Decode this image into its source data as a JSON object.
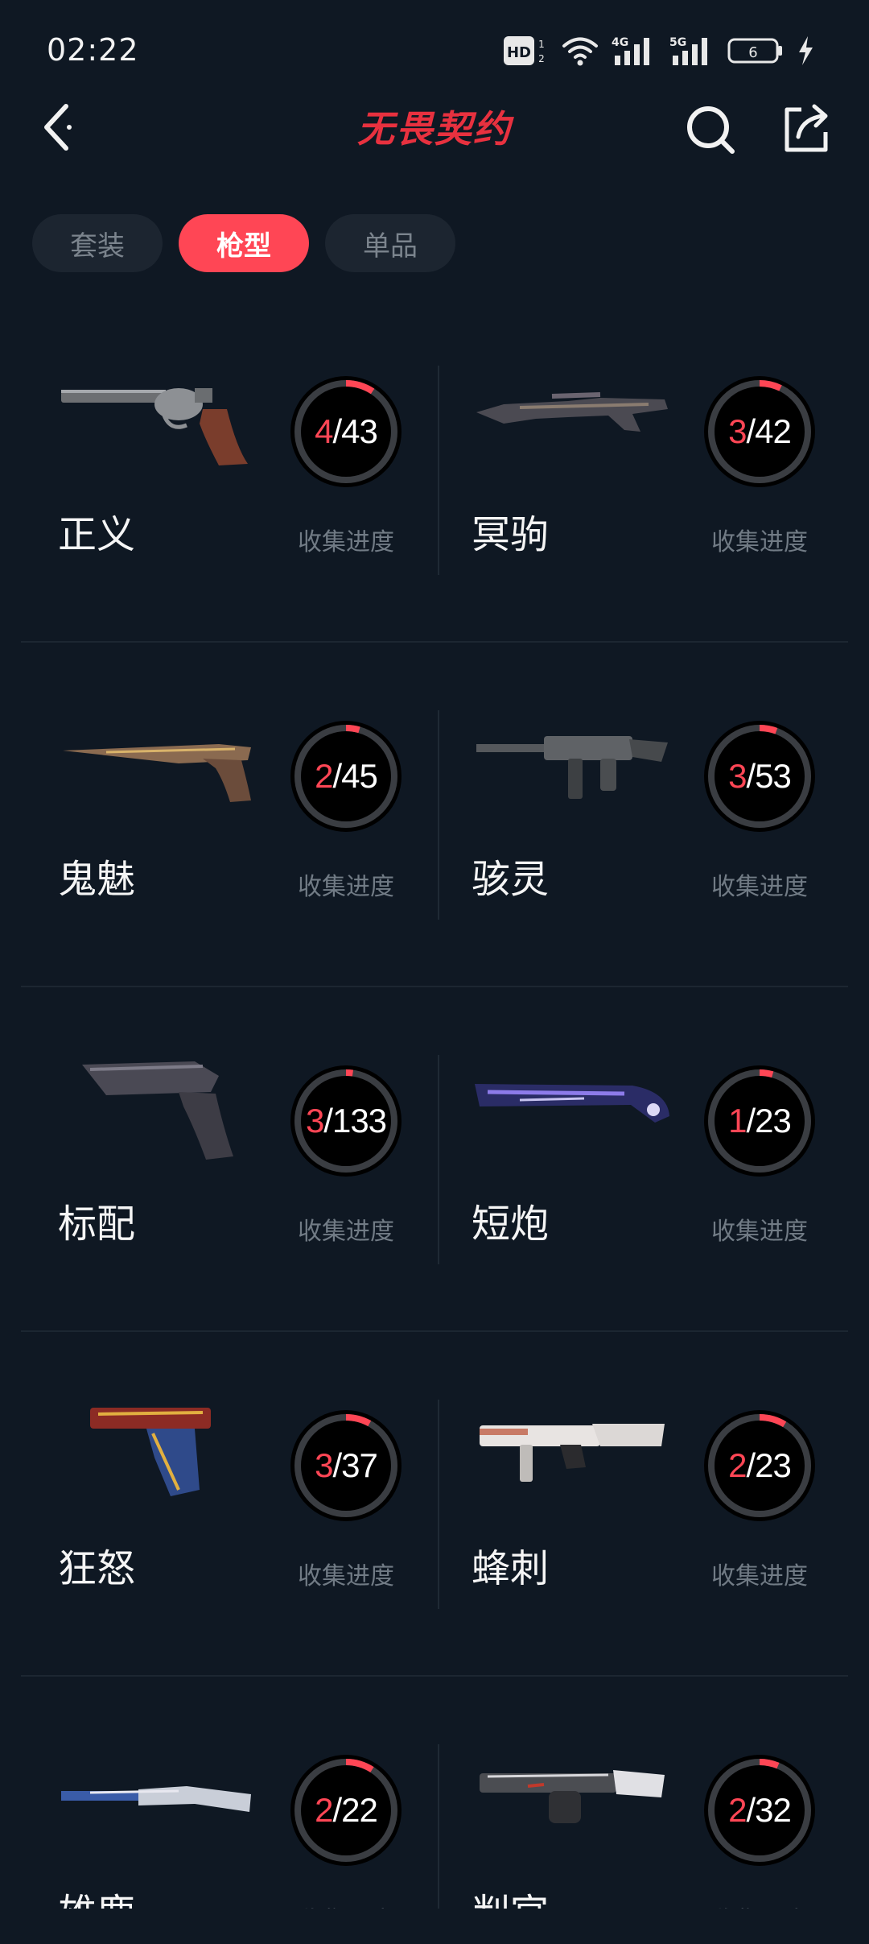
{
  "status": {
    "time": "02:22",
    "hd": "HD",
    "net1": "4G",
    "net2": "5G",
    "battery": "6"
  },
  "header": {
    "logo_text": "无畏契约",
    "accent": "#ff4655"
  },
  "tabs": [
    {
      "label": "套装",
      "active": false
    },
    {
      "label": "枪型",
      "active": true
    },
    {
      "label": "单品",
      "active": false
    }
  ],
  "progress_label": "收集进度",
  "weapons": [
    {
      "name": "正义",
      "collected": 4,
      "total": 43,
      "progress_text": "4/43",
      "icon": "revolver-image"
    },
    {
      "name": "冥驹",
      "collected": 3,
      "total": 42,
      "progress_text": "3/42",
      "icon": "sniper-rifle-image"
    },
    {
      "name": "鬼魅",
      "collected": 2,
      "total": 45,
      "progress_text": "2/45",
      "icon": "pistol-image"
    },
    {
      "name": "骇灵",
      "collected": 3,
      "total": 53,
      "progress_text": "3/53",
      "icon": "smg-image"
    },
    {
      "name": "标配",
      "collected": 3,
      "total": 133,
      "progress_text": "3/133",
      "icon": "pistol-image"
    },
    {
      "name": "短炮",
      "collected": 1,
      "total": 23,
      "progress_text": "1/23",
      "icon": "short-shotgun-image"
    },
    {
      "name": "狂怒",
      "collected": 3,
      "total": 37,
      "progress_text": "3/37",
      "icon": "machine-pistol-image"
    },
    {
      "name": "蜂刺",
      "collected": 2,
      "total": 23,
      "progress_text": "2/23",
      "icon": "smg-image"
    },
    {
      "name": "雄鹿",
      "collected": 2,
      "total": 22,
      "progress_text": "2/22",
      "icon": "shotgun-image"
    },
    {
      "name": "判官",
      "collected": 2,
      "total": 32,
      "progress_text": "2/32",
      "icon": "auto-shotgun-image"
    }
  ]
}
